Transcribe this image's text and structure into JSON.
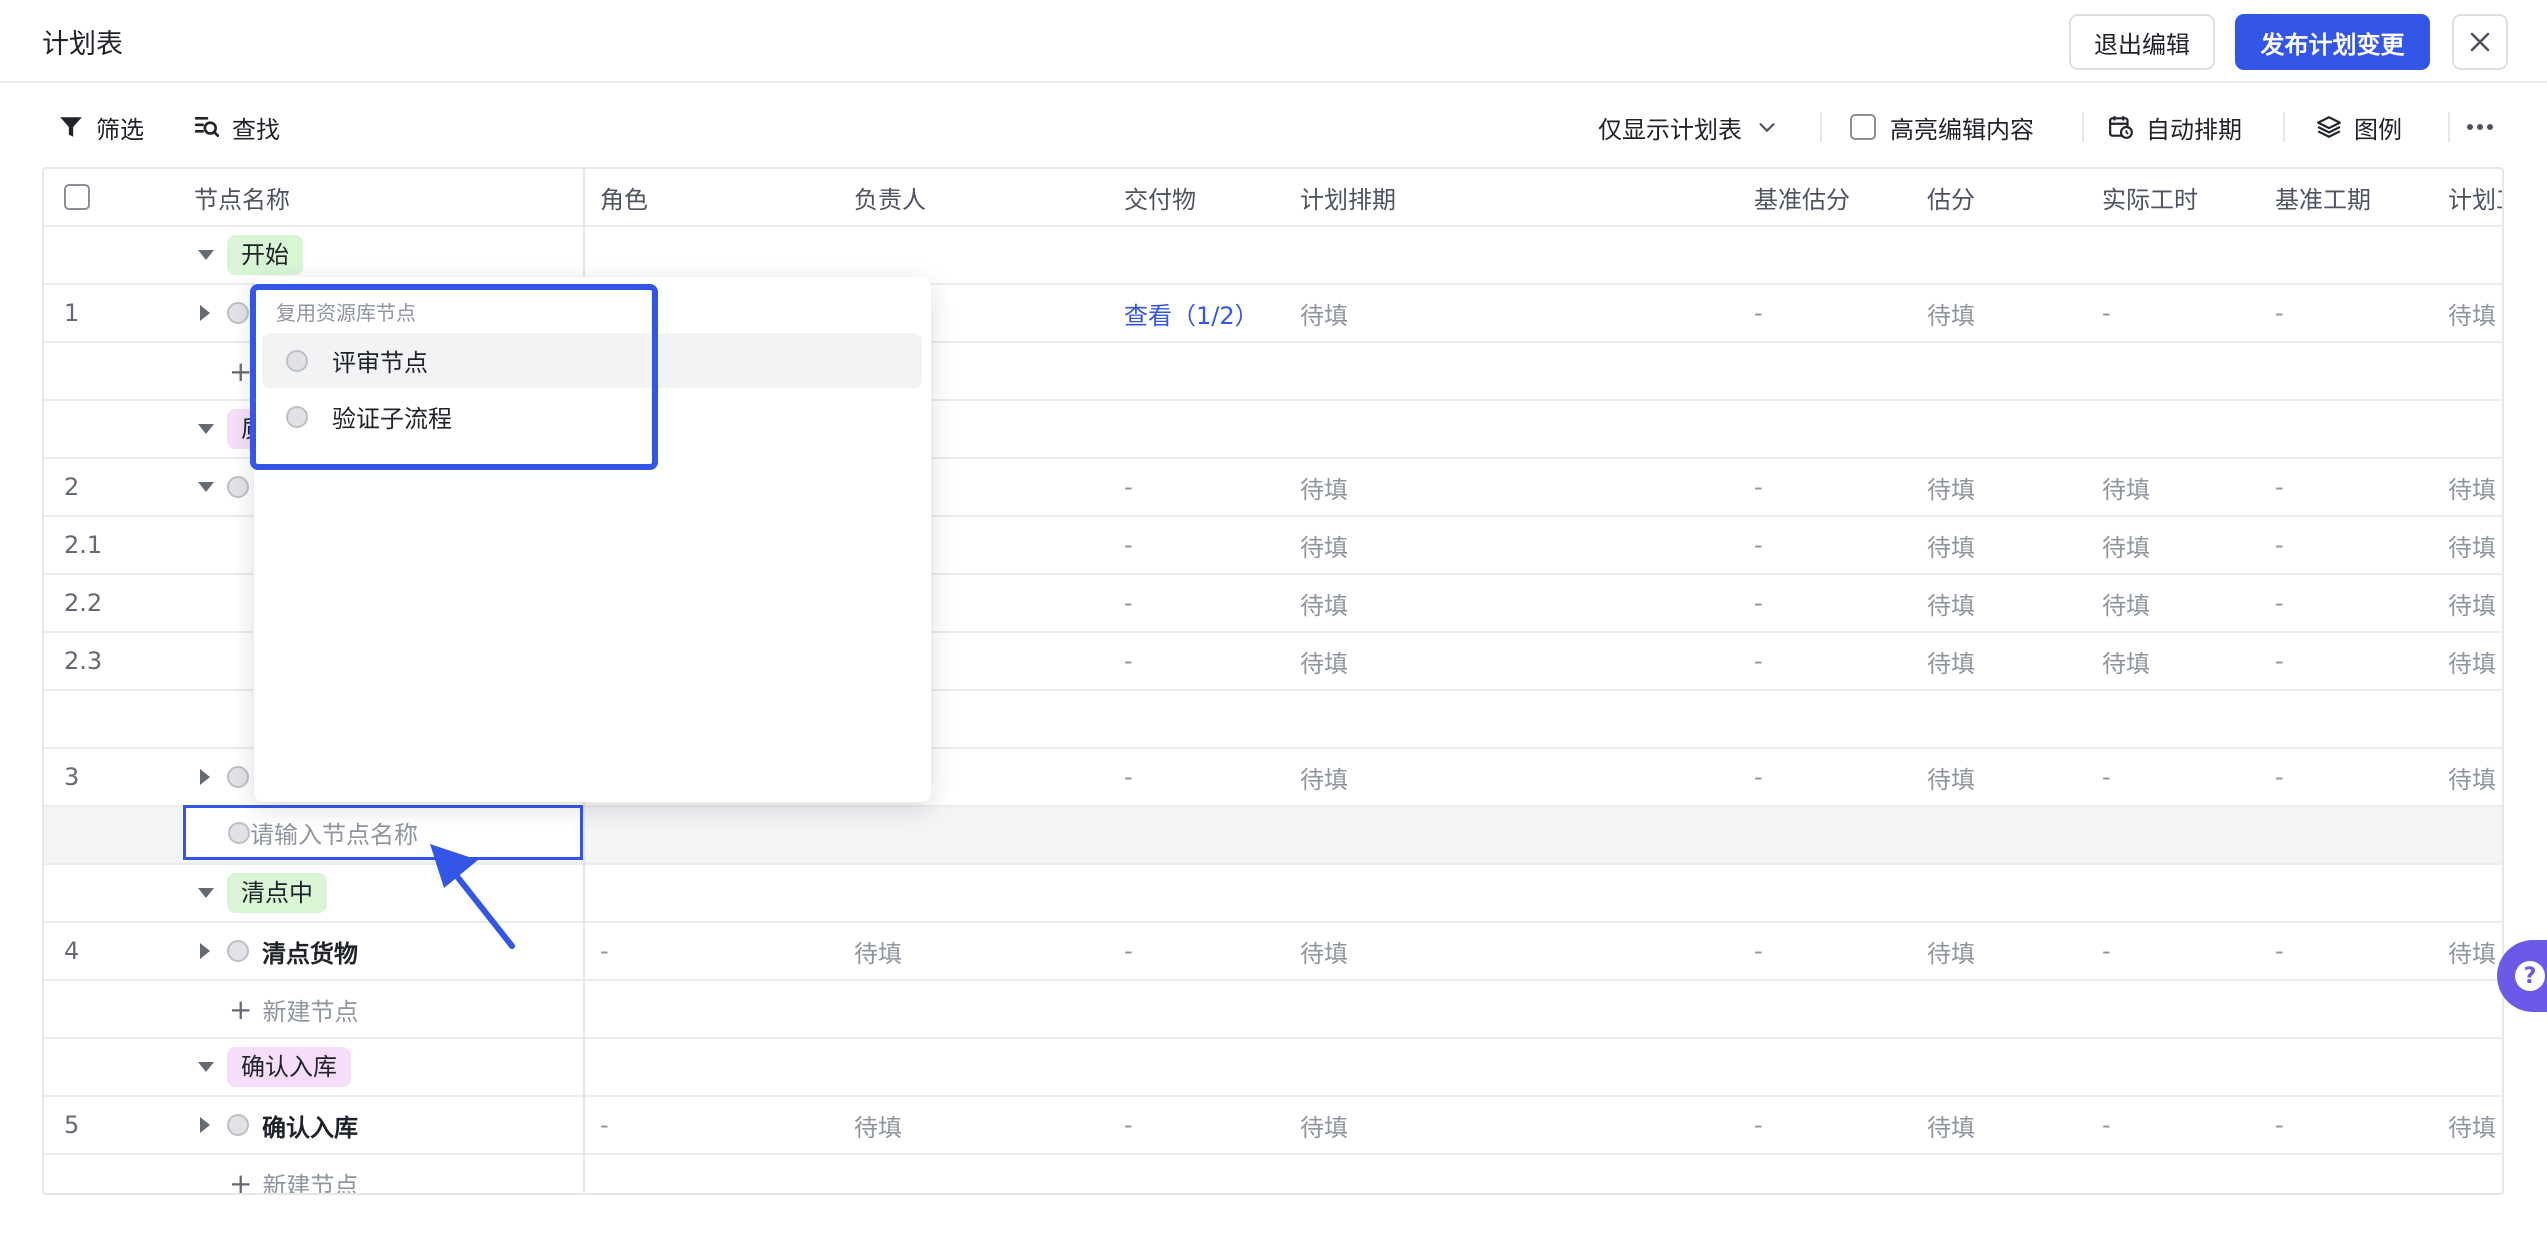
{
  "header": {
    "title": "计划表",
    "exit_label": "退出编辑",
    "publish_label": "发布计划变更"
  },
  "toolbar": {
    "filter_label": "筛选",
    "search_label": "查找",
    "view_select": "仅显示计划表",
    "highlight_label": "高亮编辑内容",
    "auto_schedule_label": "自动排期",
    "legend_label": "图例"
  },
  "columns": [
    "节点名称",
    "角色",
    "负责人",
    "交付物",
    "计划排期",
    "基准估分",
    "估分",
    "实际工时",
    "基准工期",
    "计划工"
  ],
  "groups": {
    "start": "开始",
    "counting": "清点中",
    "confirm": "确认入库"
  },
  "rows": [
    {
      "idx": "1",
      "deliverable": "查看（1/2）",
      "schedule": "待填",
      "base_est": "-",
      "est": "待填",
      "actual": "-",
      "base_dur": "-",
      "plan": "待填"
    },
    {
      "idx": "2",
      "deliverable": "-",
      "schedule": "待填",
      "base_est": "-",
      "est": "待填",
      "actual": "待填",
      "base_dur": "-",
      "plan": "待填"
    },
    {
      "idx": "2.1",
      "deliverable": "-",
      "schedule": "待填",
      "base_est": "-",
      "est": "待填",
      "actual": "待填",
      "base_dur": "-",
      "plan": "待填"
    },
    {
      "idx": "2.2",
      "deliverable": "-",
      "schedule": "待填",
      "base_est": "-",
      "est": "待填",
      "actual": "待填",
      "base_dur": "-",
      "plan": "待填"
    },
    {
      "idx": "2.3",
      "deliverable": "-",
      "schedule": "待填",
      "base_est": "-",
      "est": "待填",
      "actual": "待填",
      "base_dur": "-",
      "plan": "待填"
    },
    {
      "idx": "3",
      "deliverable": "-",
      "schedule": "待填",
      "base_est": "-",
      "est": "待填",
      "actual": "-",
      "base_dur": "-",
      "plan": "待填"
    },
    {
      "idx": "4",
      "name": "清点货物",
      "role": "-",
      "owner": "待填",
      "deliverable": "-",
      "schedule": "待填",
      "base_est": "-",
      "est": "待填",
      "actual": "-",
      "base_dur": "-",
      "plan": "待填"
    },
    {
      "idx": "5",
      "name": "确认入库",
      "role": "-",
      "owner": "待填",
      "deliverable": "-",
      "schedule": "待填",
      "base_est": "-",
      "est": "待填",
      "actual": "-",
      "base_dur": "-",
      "plan": "待填"
    }
  ],
  "new_node_label": "新建节点",
  "new_node_plus": "+",
  "partial_group_char": "质",
  "node_input": {
    "placeholder": "请输入节点名称"
  },
  "dropdown": {
    "section_title": "复用资源库节点",
    "items": [
      "评审节点",
      "验证子流程"
    ]
  },
  "help_symbol": "?"
}
